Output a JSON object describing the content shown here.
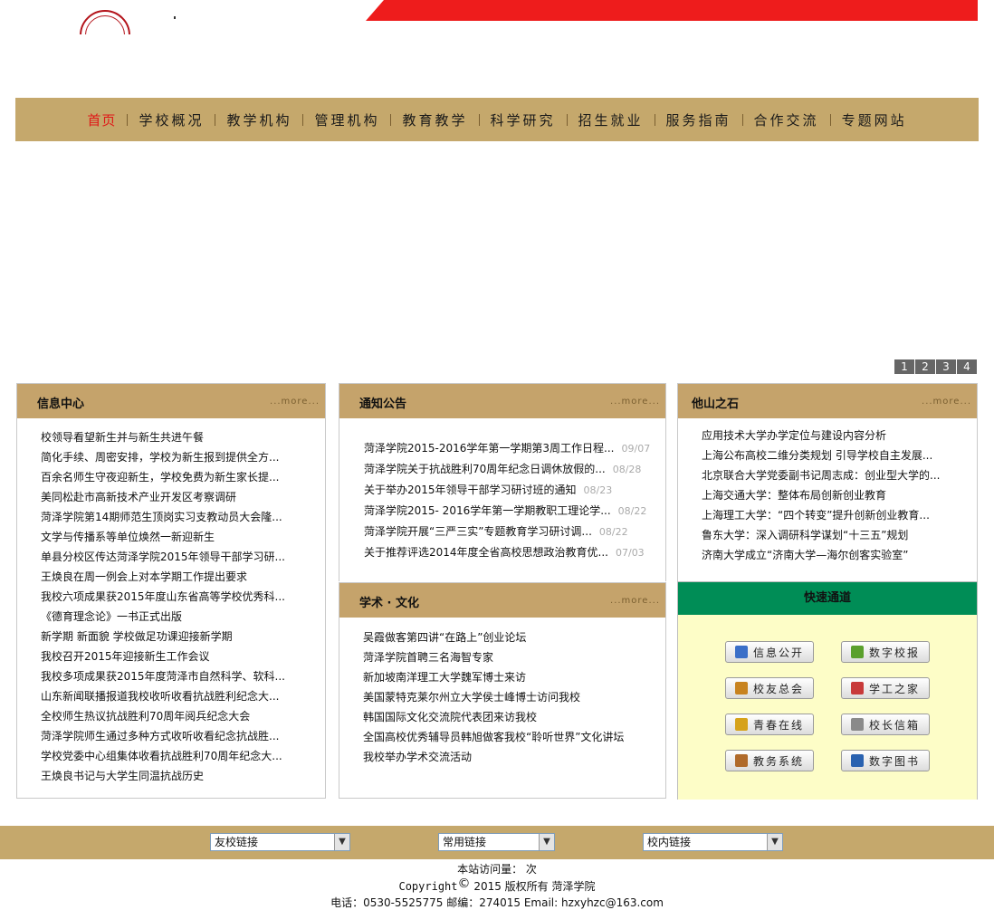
{
  "nav": {
    "items": [
      "首页",
      "学校概况",
      "教学机构",
      "管理机构",
      "教育教学",
      "科学研究",
      "招生就业",
      "服务指南",
      "合作交流",
      "专题网站"
    ]
  },
  "slider": {
    "pages": [
      "1",
      "2",
      "3",
      "4"
    ]
  },
  "info_center": {
    "title": "信息中心",
    "more": "...more...",
    "items": [
      "校领导看望新生并与新生共进午餐",
      "简化手续、周密安排，学校为新生报到提供全方...",
      "百余名师生守夜迎新生，学校免费为新生家长提...",
      "美同松赴市高新技术产业开发区考察调研",
      "菏泽学院第14期师范生顶岗实习支教动员大会隆...",
      "文学与传播系等单位焕然一新迎新生",
      "单县分校区传达菏泽学院2015年领导干部学习研...",
      "王焕良在周一例会上对本学期工作提出要求",
      "我校六项成果获2015年度山东省高等学校优秀科...",
      "《德育理念论》一书正式出版",
      "新学期 新面貌 学校做足功课迎接新学期",
      "我校召开2015年迎接新生工作会议",
      "我校多项成果获2015年度菏泽市自然科学、软科...",
      "山东新闻联播报道我校收听收看抗战胜利纪念大...",
      "全校师生热议抗战胜利70周年阅兵纪念大会",
      "菏泽学院师生通过多种方式收听收看纪念抗战胜...",
      "学校党委中心组集体收看抗战胜利70周年纪念大...",
      "王焕良书记与大学生同温抗战历史"
    ]
  },
  "notice": {
    "title": "通知公告",
    "more": "...more...",
    "items": [
      {
        "text": "菏泽学院2015-2016学年第一学期第3周工作日程...",
        "date": "09/07"
      },
      {
        "text": "菏泽学院关于抗战胜利70周年纪念日调休放假的...",
        "date": "08/28"
      },
      {
        "text": "关于举办2015年领导干部学习研讨班的通知",
        "date": "08/23"
      },
      {
        "text": "菏泽学院2015- 2016学年第一学期教职工理论学...",
        "date": "08/22"
      },
      {
        "text": "菏泽学院开展“三严三实”专题教育学习研讨调...",
        "date": "08/22"
      },
      {
        "text": "关于推荐评选2014年度全省高校思想政治教育优...",
        "date": "07/03"
      }
    ]
  },
  "academic": {
    "title": "学术 · 文化",
    "more": "...more...",
    "items": [
      "吴霞做客第四讲“在路上”创业论坛",
      "菏泽学院首聘三名海智专家",
      "新加坡南洋理工大学魏军博士来访",
      "美国蒙特克莱尔州立大学侯士峰博士访问我校",
      "韩国国际文化交流院代表团来访我校",
      "全国高校优秀辅导员韩旭做客我校“聆听世界”文化讲坛",
      "我校举办学术交流活动"
    ]
  },
  "other_stone": {
    "title": "他山之石",
    "more": "...more...",
    "items": [
      "应用技术大学办学定位与建设内容分析",
      "上海公布高校二维分类规划 引导学校自主发展...",
      "北京联合大学党委副书记周志成：创业型大学的...",
      "上海交通大学：整体布局创新创业教育",
      "上海理工大学：“四个转变”提升创新创业教育...",
      "鲁东大学：深入调研科学谋划“十三五”规划",
      "济南大学成立“济南大学—海尔创客实验室”"
    ]
  },
  "quick": {
    "title": "快速通道",
    "buttons": [
      {
        "label": "信息公开",
        "icon": "document-icon",
        "color": "#3a6fc8"
      },
      {
        "label": "数字校报",
        "icon": "folder-icon",
        "color": "#5aa02c"
      },
      {
        "label": "校友总会",
        "icon": "people-icon",
        "color": "#c8831f"
      },
      {
        "label": "学工之家",
        "icon": "couple-icon",
        "color": "#c83a3a"
      },
      {
        "label": "青春在线",
        "icon": "pencil-icon",
        "color": "#d6a21a"
      },
      {
        "label": "校长信箱",
        "icon": "mail-icon",
        "color": "#8a8a8a"
      },
      {
        "label": "教务系统",
        "icon": "trash-icon",
        "color": "#b06a2a"
      },
      {
        "label": "数字图书",
        "icon": "book-icon",
        "color": "#2a62b0"
      }
    ]
  },
  "footer": {
    "selects": [
      "友校链接",
      "常用链接",
      "校内链接"
    ],
    "visits": "本站访问量：  次",
    "copyright_prefix": "Copyright",
    "copyright_symbol": "©",
    "copyright_rest": " 2015  版权所有  菏泽学院",
    "contact": "电话：0530-5525775  邮编：274015 Email: hzxyhzc@163.com"
  }
}
